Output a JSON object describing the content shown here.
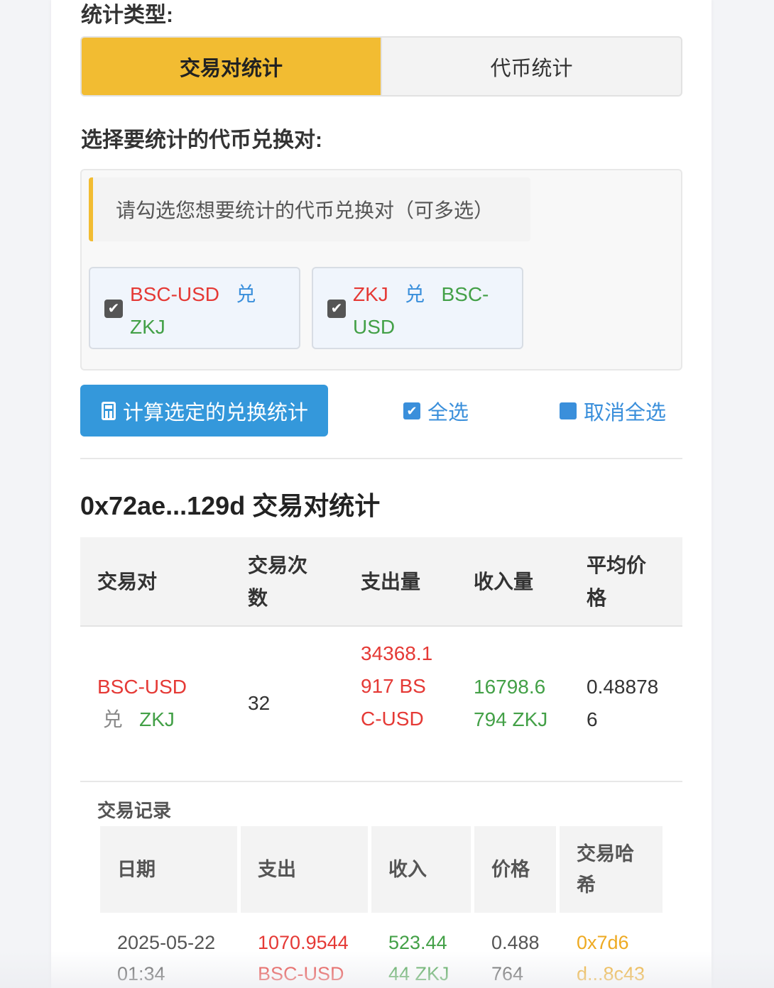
{
  "stat_type_label": "统计类型:",
  "tabs": {
    "pair": "交易对统计",
    "token": "代币统计"
  },
  "select_label": "选择要统计的代币兑换对:",
  "hint": "请勾选您想要统计的代币兑换对（可多选）",
  "pairs": [
    {
      "from": "BSC-USD",
      "sep": "兑",
      "to": "ZKJ",
      "checked": true
    },
    {
      "from": "ZKJ",
      "sep": "兑",
      "to": "BSC-USD",
      "checked": true
    }
  ],
  "actions": {
    "calc": "计算选定的兑换统计",
    "select_all": "全选",
    "deselect_all": "取消全选"
  },
  "summary": {
    "title": "0x72ae...129d 交易对统计",
    "headers": [
      "交易对",
      "交易次数",
      "支出量",
      "收入量",
      "平均价格"
    ],
    "row": {
      "pair_from": "BSC-USD",
      "pair_sep": "兑",
      "pair_to": "ZKJ",
      "count": "32",
      "out": "34368.1917 BSC-USD",
      "in": "16798.6794 ZKJ",
      "avg": "0.488786"
    }
  },
  "records": {
    "label": "交易记录",
    "headers": [
      "日期",
      "支出",
      "收入",
      "价格",
      "交易哈希"
    ],
    "rows": [
      {
        "date": "2025-05-22 01:34",
        "out": "1070.9544 BSC-USD",
        "in": "523.4444 ZKJ",
        "price": "0.488764",
        "hash": "0x7d6d...8c43"
      }
    ]
  }
}
